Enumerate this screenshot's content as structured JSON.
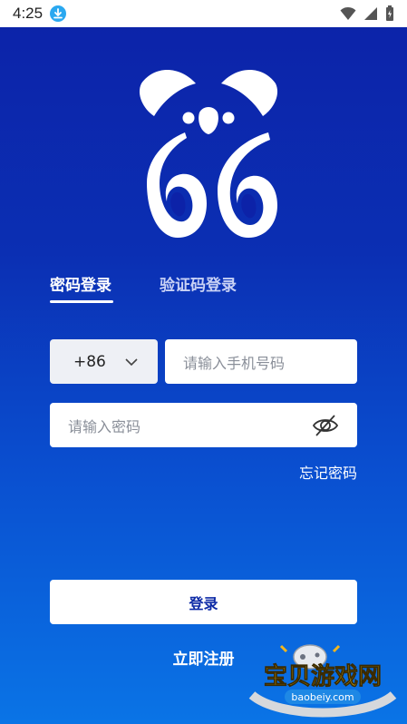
{
  "status_bar": {
    "time": "4:25"
  },
  "tabs": [
    {
      "label": "密码登录",
      "active": true
    },
    {
      "label": "验证码登录",
      "active": false
    }
  ],
  "country_code": {
    "value": "+86"
  },
  "phone": {
    "placeholder": "请输入手机号码"
  },
  "password": {
    "placeholder": "请输入密码"
  },
  "forgot_label": "忘记密码",
  "login_label": "登录",
  "register_label": "立即注册",
  "watermark": {
    "title": "宝贝游戏网",
    "url": "baobeiy.com"
  },
  "colors": {
    "brand_blue": "#0d2aa6",
    "bg_top": "#0c22a8",
    "bg_bottom": "#0a74e6"
  }
}
